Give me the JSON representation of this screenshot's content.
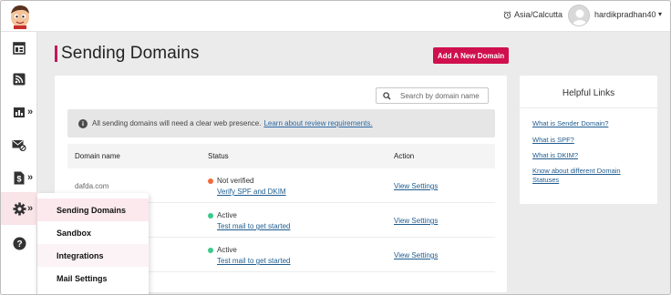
{
  "header": {
    "timezone": "Asia/Calcutta",
    "username": "hardikpradhan40",
    "logo_icon": "cartoon-boy-logo"
  },
  "sidebar": {
    "items": [
      {
        "icon": "dashboard-icon"
      },
      {
        "icon": "rss-feed-icon"
      },
      {
        "icon": "analytics-icon",
        "has_submenu": true
      },
      {
        "icon": "mail-block-icon"
      },
      {
        "icon": "billing-icon",
        "has_submenu": true
      },
      {
        "icon": "gear-icon",
        "has_submenu": true,
        "active": true
      },
      {
        "icon": "help-icon"
      }
    ],
    "submenu_arrow": "»"
  },
  "flyout": {
    "items": [
      {
        "label": "Sending Domains",
        "active": true
      },
      {
        "label": "Sandbox"
      },
      {
        "label": "Integrations"
      },
      {
        "label": "Mail Settings"
      }
    ]
  },
  "page": {
    "title": "Sending Domains",
    "add_button": "Add A New Domain"
  },
  "search": {
    "placeholder": "Search by domain name"
  },
  "notice": {
    "text": "All sending domains will need a clear web presence.",
    "link": "Learn about review requirements."
  },
  "table": {
    "headers": [
      "Domain name",
      "Status",
      "Action"
    ],
    "rows": [
      {
        "domain": "dafda.com",
        "status": "Not verified",
        "status_color": "#f26b3a",
        "status_link": "Verify SPF and DKIM",
        "action": "View Settings"
      },
      {
        "domain": "",
        "status": "Active",
        "status_color": "#3cc98a",
        "status_link": "Test mail to get started",
        "action": "View Settings"
      },
      {
        "domain": "",
        "status": "Active",
        "status_color": "#3cc98a",
        "status_link": "Test mail to get started",
        "action": "View Settings"
      }
    ]
  },
  "helpful_links": {
    "title": "Helpful Links",
    "links": [
      "What is Sender Domain?",
      "What is SPF?",
      "What is DKIM?",
      "Know about different Domain Statuses"
    ]
  },
  "colors": {
    "accent": "#d00f4f",
    "link": "#1f5c8f",
    "active_dot": "#3cc98a",
    "warning_dot": "#f26b3a"
  }
}
